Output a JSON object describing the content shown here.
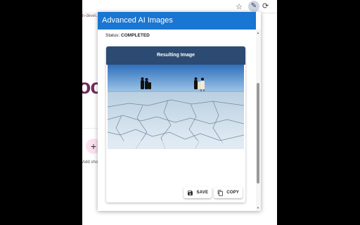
{
  "background": {
    "link_text": "n-devel...",
    "logo_fragment": "oc",
    "add_button_symbol": "+",
    "add_label": "Add sho"
  },
  "toolbar": {
    "star_icon": "star-icon",
    "extension_icon": "puzzle-icon",
    "reload_icon": "reload-icon"
  },
  "popup": {
    "title": "Advanced AI Images",
    "status_label": "Status:",
    "status_value": "COMPLETED",
    "card_title": "Resulting Image",
    "save_label": "SAVE",
    "copy_label": "COPY"
  },
  "colors": {
    "header": "#1976d2",
    "card_header": "#2d4a72"
  }
}
